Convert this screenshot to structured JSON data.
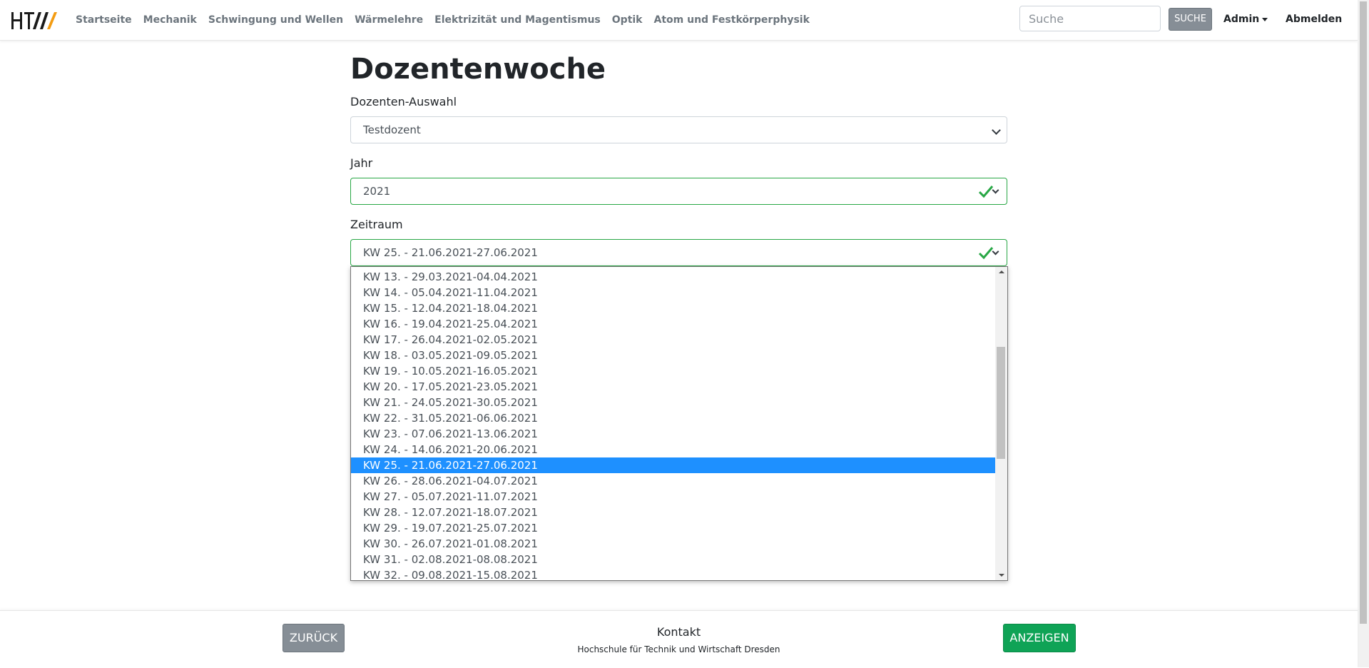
{
  "nav": {
    "links": [
      "Startseite",
      "Mechanik",
      "Schwingung und Wellen",
      "Wärmelehre",
      "Elektrizität und Magentismus",
      "Optik",
      "Atom und Festkörperphysik"
    ],
    "search_placeholder": "Suche",
    "search_button": "SUCHE",
    "admin_label": "Admin",
    "logout_label": "Abmelden"
  },
  "page": {
    "title": "Dozentenwoche",
    "lecturer_label": "Dozenten-Auswahl",
    "lecturer_value": "Testdozent",
    "year_label": "Jahr",
    "year_value": "2021",
    "period_label": "Zeitraum",
    "period_value": "KW 25. - 21.06.2021-27.06.2021"
  },
  "dropdown": {
    "options": [
      "KW 13. - 29.03.2021-04.04.2021",
      "KW 14. - 05.04.2021-11.04.2021",
      "KW 15. - 12.04.2021-18.04.2021",
      "KW 16. - 19.04.2021-25.04.2021",
      "KW 17. - 26.04.2021-02.05.2021",
      "KW 18. - 03.05.2021-09.05.2021",
      "KW 19. - 10.05.2021-16.05.2021",
      "KW 20. - 17.05.2021-23.05.2021",
      "KW 21. - 24.05.2021-30.05.2021",
      "KW 22. - 31.05.2021-06.06.2021",
      "KW 23. - 07.06.2021-13.06.2021",
      "KW 24. - 14.06.2021-20.06.2021",
      "KW 25. - 21.06.2021-27.06.2021",
      "KW 26. - 28.06.2021-04.07.2021",
      "KW 27. - 05.07.2021-11.07.2021",
      "KW 28. - 12.07.2021-18.07.2021",
      "KW 29. - 19.07.2021-25.07.2021",
      "KW 30. - 26.07.2021-01.08.2021",
      "KW 31. - 02.08.2021-08.08.2021",
      "KW 32. - 09.08.2021-15.08.2021"
    ],
    "selected": "KW 25. - 21.06.2021-27.06.2021"
  },
  "footer": {
    "back_button": "ZURÜCK",
    "contact": "Kontakt",
    "school": "Hochschule für Technik und Wirtschaft Dresden",
    "show_button": "ANZEIGEN"
  },
  "colors": {
    "accent_orange": "#f39c12",
    "valid_green": "#28a745",
    "selected_blue": "#1e90ff",
    "show_green": "#0fa356",
    "secondary_gray": "#868e96"
  }
}
